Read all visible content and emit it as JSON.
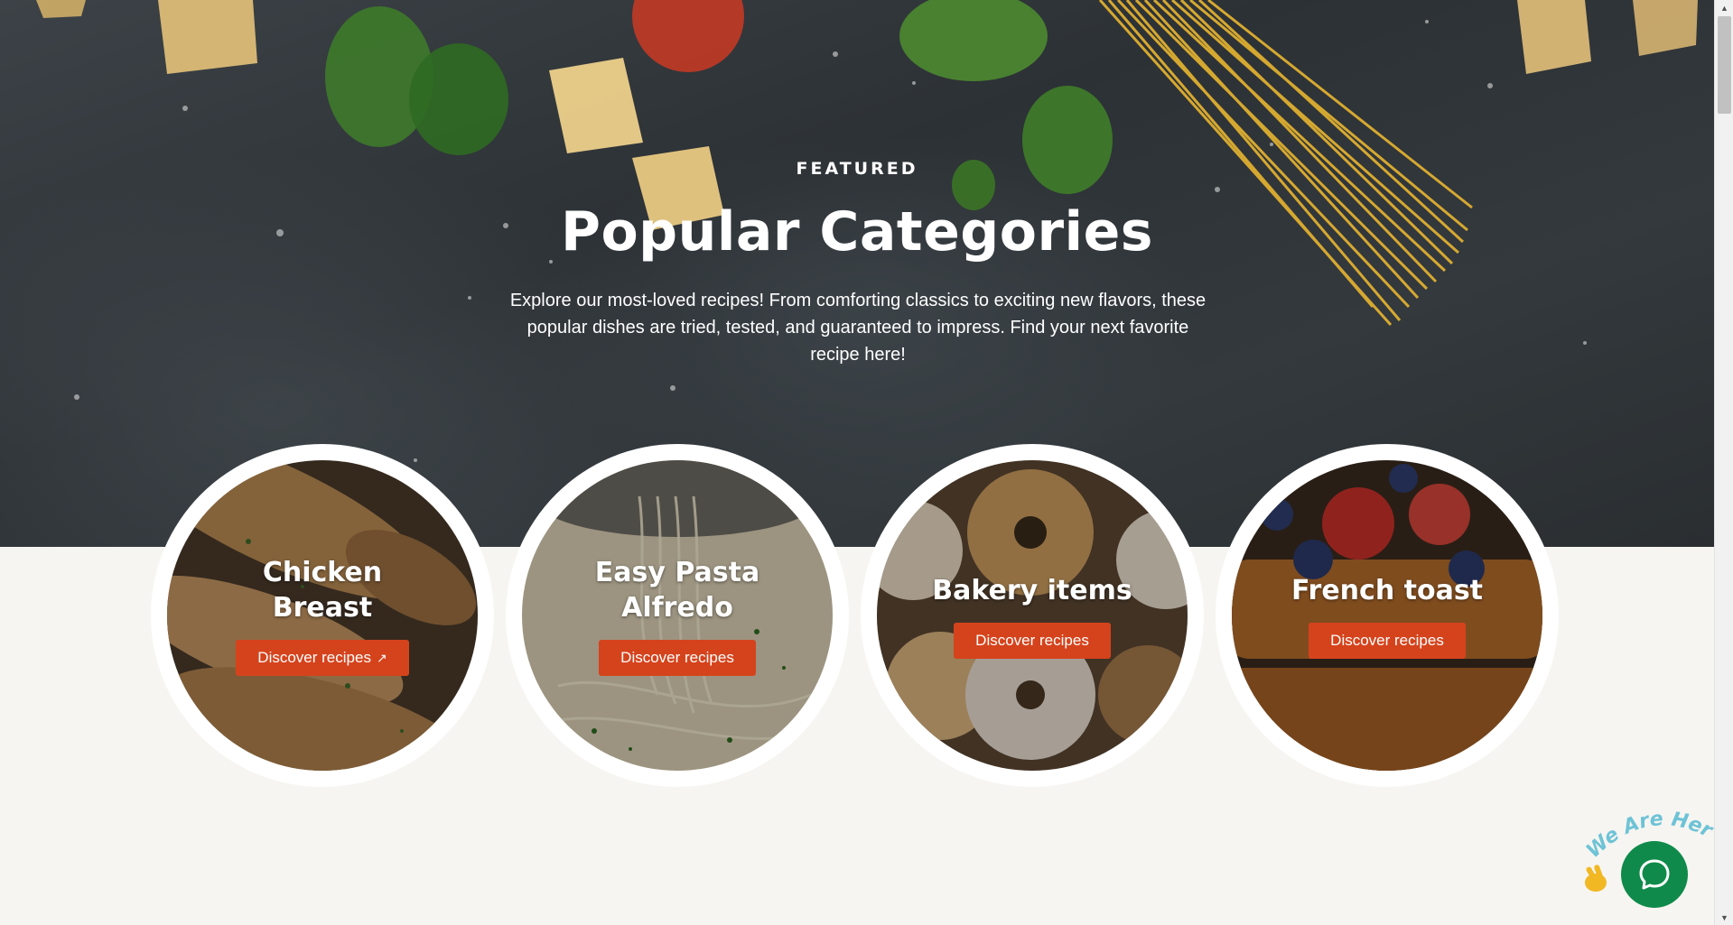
{
  "hero": {
    "eyebrow": "FEATURED",
    "title": "Popular Categories",
    "description": "Explore our most-loved recipes! From comforting classics to exciting new flavors, these popular dishes are tried, tested, and guaranteed to impress. Find your next favorite recipe here!"
  },
  "categories": [
    {
      "title": "Chicken Breast",
      "button": "Discover recipes",
      "button_icon": "arrow-up-right-icon"
    },
    {
      "title": "Easy Pasta Alfredo",
      "button": "Discover recipes"
    },
    {
      "title": "Bakery items",
      "button": "Discover recipes"
    },
    {
      "title": "French toast",
      "button": "Discover recipes"
    }
  ],
  "chat_widget": {
    "badge_text": "We Are Here!",
    "icon": "chat-bubble-icon",
    "wave_icon": "waving-hand-icon"
  },
  "colors": {
    "accent": "#d5431c",
    "chat": "#0f8a4a",
    "page_bg": "#f6f5f1"
  }
}
